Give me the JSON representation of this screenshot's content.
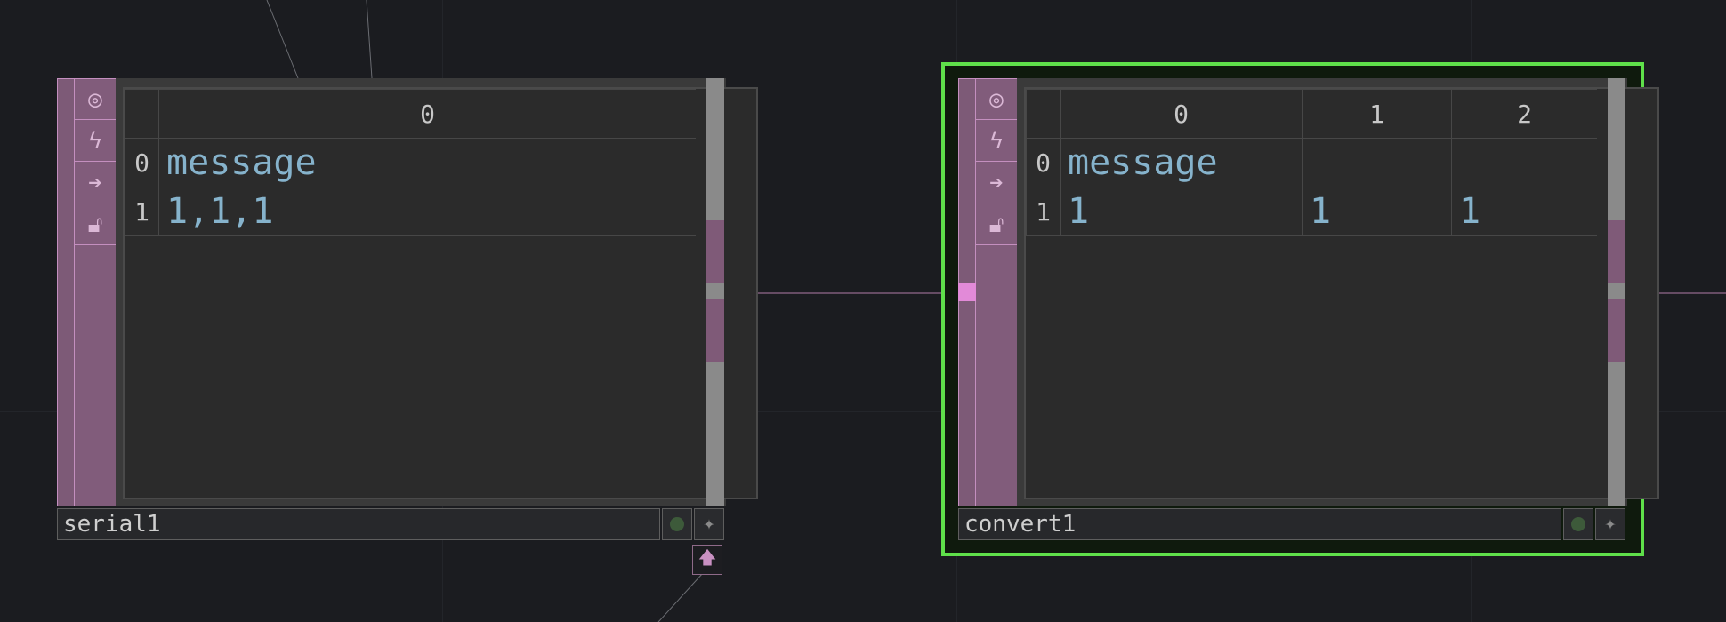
{
  "nodes": [
    {
      "name": "serial1",
      "header": [
        "0"
      ],
      "rows": [
        {
          "index": "0",
          "cells": [
            "message"
          ]
        },
        {
          "index": "1",
          "cells": [
            "1,1,1"
          ]
        }
      ]
    },
    {
      "name": "convert1",
      "header": [
        "0",
        "1",
        "2"
      ],
      "rows": [
        {
          "index": "0",
          "cells": [
            "message",
            "",
            ""
          ]
        },
        {
          "index": "1",
          "cells": [
            "1",
            "1",
            "1"
          ]
        }
      ]
    }
  ],
  "icons": {
    "viewer_flag": "eye-icon",
    "cook_flag": "lightning-icon",
    "bypass_flag": "arrow-right-icon",
    "lock_flag": "lock-icon",
    "display": "circle-dot-icon",
    "pin": "star-icon",
    "export": "arrow-up-icon"
  },
  "colors": {
    "background": "#1b1c20",
    "operator_family": "#7d5a77",
    "selection": "#5fe04a",
    "cell_text": "#86b3cc"
  }
}
